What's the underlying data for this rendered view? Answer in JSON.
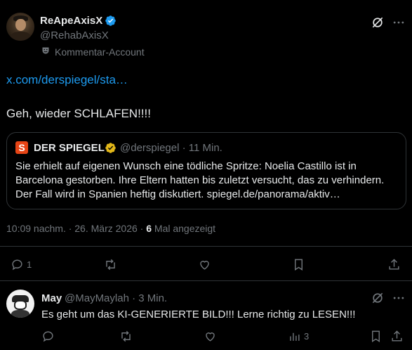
{
  "post": {
    "author_name": "ReApeAxisX",
    "author_handle": "@RehabAxisX",
    "account_label": "Kommentar-Account",
    "link_text": "x.com/derspiegel/sta…",
    "text": "Geh, wieder SCHLAFEN!!!!",
    "timestamp": "10:09 nachm. · 26. März 2026 ·",
    "views_count": "6",
    "views_label": "Mal angezeigt",
    "actions": {
      "reply_count": "1",
      "repost_count": "",
      "like_count": ""
    }
  },
  "quote": {
    "logo_letter": "S",
    "name": "DER SPIEGEL",
    "meta": "@derspiegel · 11 Min.",
    "body": "Sie erhielt auf eigenen Wunsch eine tödliche Spritze: Noelia Castillo ist in Barcelona gestorben. Ihre Eltern hatten bis zuletzt versucht, das zu verhindern. Der Fall wird in Spanien heftig diskutiert. spiegel.de/panorama/aktiv…"
  },
  "reply": {
    "author_name": "May",
    "meta": "@MayMaylah · 3 Min.",
    "text": "Es geht um das KI-GENERIERTE BILD!!! Lerne richtig zu LESEN!!!",
    "views_count": "3"
  },
  "colors": {
    "background": "#000000",
    "text": "#e7e9ea",
    "muted": "#71767b",
    "link": "#1d9bf0",
    "verified_blue": "#1d9bf0",
    "verified_gold": "#e2b719",
    "spiegel_red": "#e64415",
    "border": "#2f3336"
  }
}
